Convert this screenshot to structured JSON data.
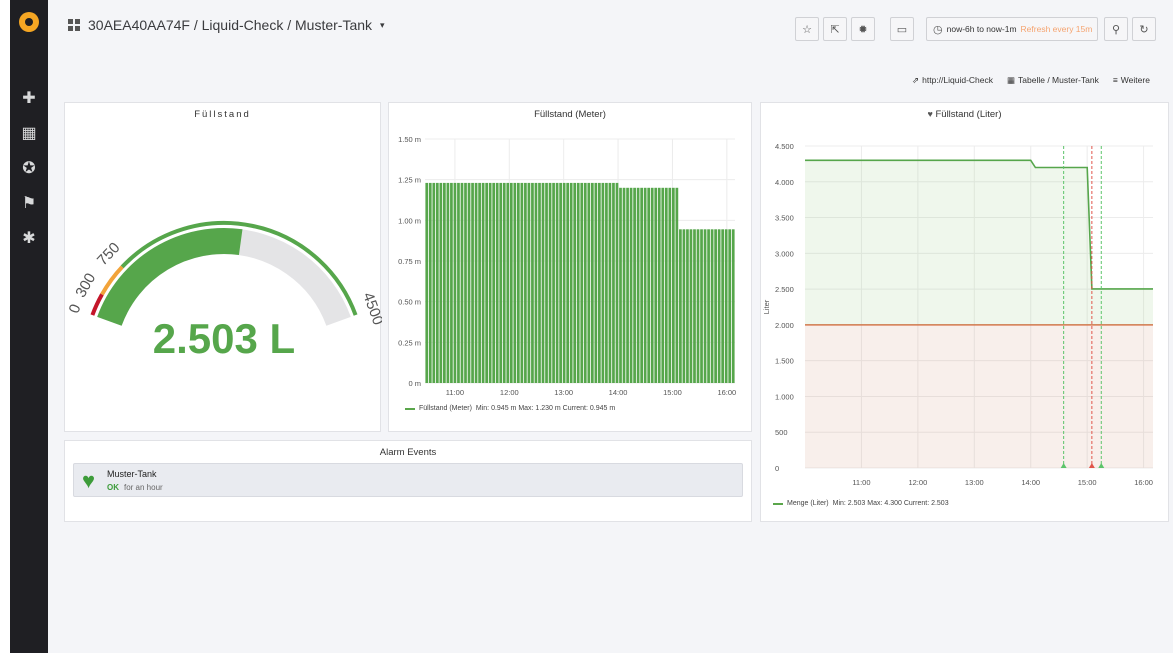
{
  "header": {
    "breadcrumb": "30AEA40AA74F / Liquid-Check / Muster-Tank",
    "time_range": "now-6h to now-1m",
    "refresh": "Refresh every 15m"
  },
  "subnav": {
    "link": "http://Liquid-Check",
    "table_link": "Tabelle / Muster-Tank",
    "more": "Weitere"
  },
  "gauge": {
    "title": "Füllstand",
    "value_text": "2.503 L",
    "value": 2503,
    "min": 0,
    "max": 4500,
    "thresholds": [
      300,
      750
    ],
    "tick_labels": [
      "0",
      "300",
      "750",
      "4500"
    ],
    "colors": {
      "red": "#c4162a",
      "orange": "#f2a33a",
      "green": "#56a64b"
    }
  },
  "alarm": {
    "title": "Alarm Events",
    "item_name": "Muster-Tank",
    "status": "OK",
    "since": "for an hour"
  },
  "chart_data": [
    {
      "type": "bar",
      "title": "Füllstand (Meter)",
      "x_ticks": [
        "11:00",
        "12:00",
        "13:00",
        "14:00",
        "15:00",
        "16:00"
      ],
      "y_ticks": [
        "1.50 m",
        "1.25 m",
        "1.00 m",
        "0.75 m",
        "0.50 m",
        "0.25 m",
        "0 m"
      ],
      "ylim": [
        0,
        1.5
      ],
      "series": [
        {
          "name": "Füllstand (Meter)",
          "segments": [
            {
              "from": "10:27",
              "to": "14:00",
              "value": 1.23
            },
            {
              "from": "14:00",
              "to": "15:05",
              "value": 1.2
            },
            {
              "from": "15:05",
              "to": "16:09",
              "value": 0.945
            }
          ],
          "color": "#56a64b"
        }
      ],
      "legend_stats": "Min: 0.945 m  Max: 1.230 m  Current: 0.945 m",
      "grid": true
    },
    {
      "type": "line",
      "title": "Füllstand (Liter)",
      "ylabel": "Liter",
      "x_ticks": [
        "11:00",
        "12:00",
        "13:00",
        "14:00",
        "15:00",
        "16:00"
      ],
      "y_ticks": [
        "4.500",
        "4.000",
        "3.500",
        "3.000",
        "2.500",
        "2.000",
        "1.500",
        "1.000",
        "500",
        "0"
      ],
      "ylim": [
        0,
        4500
      ],
      "series": [
        {
          "name": "Menge (Liter)",
          "points": [
            [
              "10:00",
              4300
            ],
            [
              "14:00",
              4300
            ],
            [
              "14:05",
              4200
            ],
            [
              "15:00",
              4200
            ],
            [
              "15:05",
              2503
            ],
            [
              "16:10",
              2503
            ]
          ],
          "color": "#56a64b"
        }
      ],
      "threshold": 2000,
      "annotations": [
        "14:35",
        "15:05",
        "15:15"
      ],
      "legend_stats": "Min: 2.503  Max: 4.300  Current: 2.503",
      "grid": true
    }
  ]
}
